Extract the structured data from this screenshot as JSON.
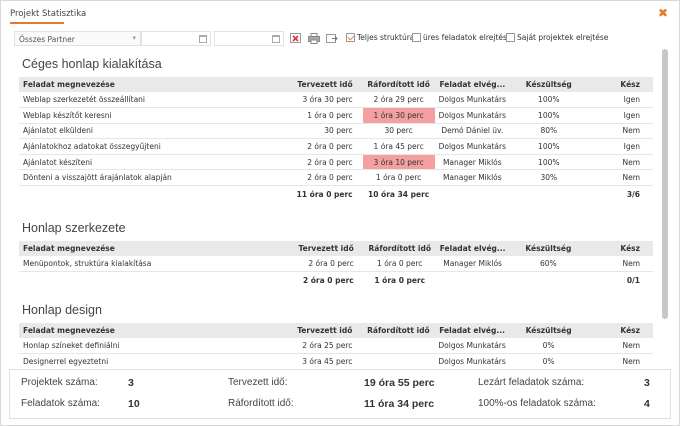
{
  "window": {
    "title": "Projekt Statisztika",
    "close_icon": "close-icon",
    "accent": "#e8782e"
  },
  "toolbar": {
    "partner_value": "Összes Partner",
    "caret": "▾",
    "checkboxes": [
      {
        "label": "Teljes struktúra",
        "checked": true
      },
      {
        "label": "üres feladatok elrejtése",
        "checked": false
      },
      {
        "label": "Saját projektek elrejtése",
        "checked": false
      }
    ]
  },
  "columns": {
    "name": "Feladat megnevezése",
    "planned": "Tervezett idő",
    "spent": "Ráfordított idő",
    "owner": "Feladat elvég...",
    "progress": "Készültség",
    "done": "Kész"
  },
  "sections": [
    {
      "title": "Céges honlap kialakítása",
      "rows": [
        {
          "name": "Weblap szerkezetét összeállítani",
          "planned": "3 óra 30 perc",
          "spent": "2 óra 29 perc",
          "over": false,
          "owner": "Dolgos Munkatárs",
          "progress": "100%",
          "done": "Igen"
        },
        {
          "name": "Weblap készítőt keresni",
          "planned": "1 óra 0 perc",
          "spent": "1 óra 30 perc",
          "over": true,
          "owner": "Dolgos Munkatárs",
          "progress": "100%",
          "done": "Igen"
        },
        {
          "name": "Ajánlatot elküldeni",
          "planned": "30 perc",
          "spent": "30 perc",
          "over": false,
          "owner": "Demó Dániel üv.",
          "progress": "80%",
          "done": "Nem"
        },
        {
          "name": "Ajánlatokhoz adatokat összegyűjteni",
          "planned": "2 óra 0 perc",
          "spent": "1 óra 45 perc",
          "over": false,
          "owner": "Dolgos Munkatárs",
          "progress": "100%",
          "done": "Igen"
        },
        {
          "name": "Ajánlatot készíteni",
          "planned": "2 óra 0 perc",
          "spent": "3 óra 10 perc",
          "over": true,
          "owner": "Manager Miklós",
          "progress": "100%",
          "done": "Nem"
        },
        {
          "name": "Dönteni a visszajött árajánlatok alapján",
          "planned": "2 óra 0 perc",
          "spent": "1 óra 0 perc",
          "over": false,
          "owner": "Manager Miklós",
          "progress": "30%",
          "done": "Nem"
        }
      ],
      "sum": {
        "planned": "11 óra 0 perc",
        "spent": "10 óra 34 perc",
        "done": "3/6"
      }
    },
    {
      "title": "Honlap szerkezete",
      "rows": [
        {
          "name": "Menüpontok, struktúra kialakítása",
          "planned": "2 óra 0 perc",
          "spent": "1 óra 0 perc",
          "over": false,
          "owner": "Manager Miklós",
          "progress": "60%",
          "done": "Nem"
        }
      ],
      "sum": {
        "planned": "2 óra 0 perc",
        "spent": "1 óra 0 perc",
        "done": "0/1"
      }
    },
    {
      "title": "Honlap design",
      "rows": [
        {
          "name": "Honlap színeket definiálni",
          "planned": "2 óra 25 perc",
          "spent": "",
          "over": false,
          "owner": "Dolgos Munkatárs",
          "progress": "0%",
          "done": "Nem"
        },
        {
          "name": "Designerrel egyeztetni",
          "planned": "3 óra 45 perc",
          "spent": "",
          "over": false,
          "owner": "Dolgos Munkatárs",
          "progress": "0%",
          "done": "Nem"
        }
      ],
      "sum": null
    }
  ],
  "footer": {
    "projects_label": "Projektek száma:",
    "projects_value": "3",
    "tasks_label": "Feladatok száma:",
    "tasks_value": "10",
    "planned_label": "Tervezett idő:",
    "planned_value": "19 óra 55 perc",
    "spent_label": "Ráfordított idő:",
    "spent_value": "11 óra 34 perc",
    "closed_label": "Lezárt feladatok száma:",
    "closed_value": "3",
    "full_label": "100%-os feladatok száma:",
    "full_value": "4"
  },
  "colors": {
    "over_budget": "#f4a0a0",
    "header_bg": "#e9e9e9"
  }
}
